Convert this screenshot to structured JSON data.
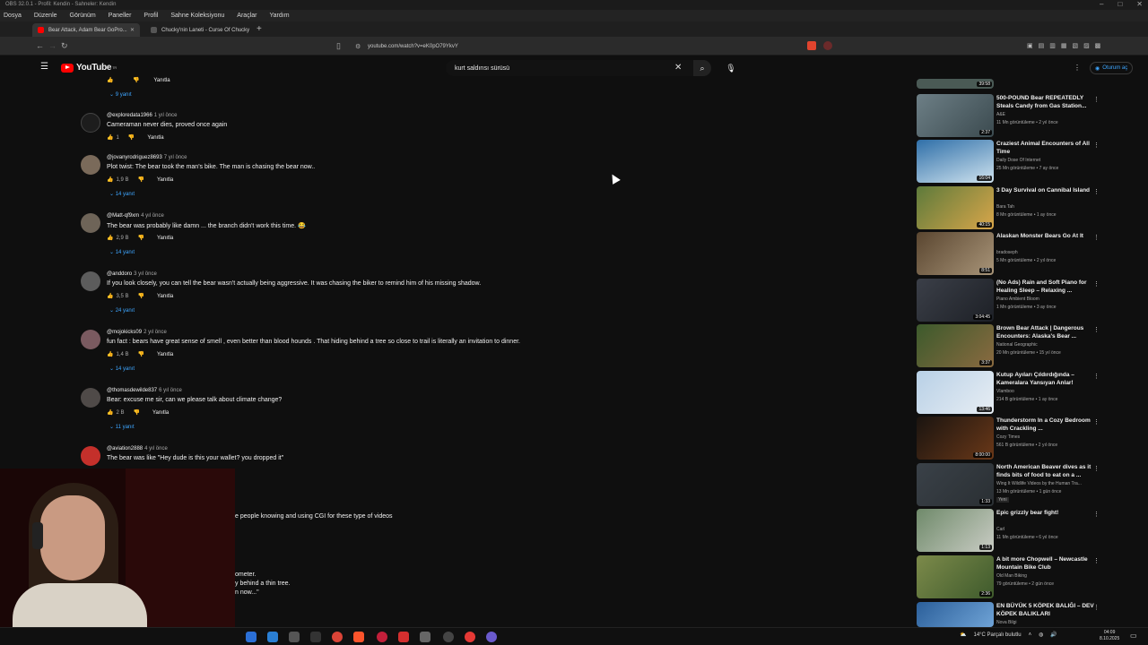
{
  "obs": {
    "title": "OBS 32.0.1 - Profil: Kendin - Sahneler: Kendin",
    "menu": [
      "Dosya",
      "Düzenle",
      "Görünüm",
      "Paneller",
      "Profil",
      "Sahne Koleksiyonu",
      "Araçlar",
      "Yardım"
    ]
  },
  "browser": {
    "tabs": [
      {
        "label": "Bear Attack, Adam Bear GoPro..."
      },
      {
        "label": "Chucky'nin Laneti - Curse Of Chucky"
      }
    ],
    "url": "youtube.com/watch?v=eK0pO79YkvY"
  },
  "youtube": {
    "logo_text": "YouTube",
    "logo_region": "TR",
    "search_value": "kurt saldırısı sürüsü",
    "signin_label": "Oturum aç"
  },
  "top_partial": {
    "replies": "9 yanıt",
    "reply_label": "Yanıtla"
  },
  "comments": [
    {
      "author": "@exploredata1966",
      "time": "1 yıl önce",
      "text": "Cameraman never dies, proved once again",
      "likes": "1",
      "reply_label": "Yanıtla",
      "replies": ""
    },
    {
      "author": "@jovanyrodriguez8693",
      "time": "7 yıl önce",
      "text": "Plot twist: The bear took the man's bike. The man is chasing the bear now..",
      "likes": "1,9 B",
      "reply_label": "Yanıtla",
      "replies": "14 yanıt"
    },
    {
      "author": "@Matt-qf9xm",
      "time": "4 yıl önce",
      "text": "The bear was probably like damn ... the branch didn't work this time. 😂",
      "likes": "2,9 B",
      "reply_label": "Yanıtla",
      "replies": "14 yanıt"
    },
    {
      "author": "@anddoro",
      "time": "3 yıl önce",
      "text": "If you look closely, you can tell the bear wasn't actually being aggressive. It was chasing the biker to remind him of his missing shadow.",
      "likes": "3,5 B",
      "reply_label": "Yanıtla",
      "replies": "24 yanıt"
    },
    {
      "author": "@mojokicks09",
      "time": "2 yıl önce",
      "text": "fun fact : bears have great sense of smell , even better than blood hounds . That hiding behind a tree so close to trail is literally an invitation to dinner.",
      "likes": "1,4 B",
      "reply_label": "Yanıtla",
      "replies": "14 yanıt"
    },
    {
      "author": "@thomasdewilde837",
      "time": "6 yıl önce",
      "text": "Bear: excuse me sir, can we please talk about climate change?",
      "likes": "2 B",
      "reply_label": "Yanıtla",
      "replies": "11 yanıt"
    },
    {
      "author": "@aviation2888",
      "time": "4 yıl önce",
      "text": "The bear was like \"Hey dude is this your wallet? you dropped it\"",
      "likes": "",
      "reply_label": "",
      "replies": ""
    }
  ],
  "partial_texts": [
    "e people knowing and using CGI for these type of videos",
    "ometer.",
    "y behind a thin tree.",
    "n now...\""
  ],
  "sidebar": [
    {
      "title": "",
      "channel": "",
      "stats": "",
      "duration": "39:58",
      "badge": ""
    },
    {
      "title": "500-POUND Bear REPEATEDLY Steals Candy from Gas Station...",
      "channel": "A&E",
      "stats": "11 Mn görüntüleme • 2 yıl önce",
      "duration": "2:37",
      "badge": ""
    },
    {
      "title": "Craziest Animal Encounters of All Time",
      "channel": "Daily Dose Of Internet",
      "stats": "25 Mn görüntüleme • 7 ay önce",
      "duration": "16:04",
      "badge": ""
    },
    {
      "title": "3 Day Survival on Cannibal Island",
      "channel": "Bara Tah",
      "stats": "8 Mn görüntüleme • 1 ay önce",
      "duration": "40:15",
      "badge": ""
    },
    {
      "title": "Alaskan Monster Bears Go At It",
      "channel": "bradoseph",
      "stats": "5 Mn görüntüleme • 2 yıl önce",
      "duration": "8:51",
      "badge": ""
    },
    {
      "title": "(No Ads) Rain and Soft Piano for Healing Sleep – Relaxing ...",
      "channel": "Piano Ambient Bloom",
      "stats": "1 Mn görüntüleme • 3 ay önce",
      "duration": "3:04:45",
      "badge": ""
    },
    {
      "title": "Brown Bear Attack | Dangerous Encounters: Alaska's Bear ...",
      "channel": "National Geographic",
      "stats": "20 Mn görüntüleme • 15 yıl önce",
      "duration": "3:37",
      "badge": ""
    },
    {
      "title": "Kutup Ayıları Çıldırdığında – Kameralara Yansıyan Anlar!",
      "channel": "Vlamboo",
      "stats": "214 B görüntüleme • 1 ay önce",
      "duration": "13:46",
      "badge": ""
    },
    {
      "title": "Thunderstorm In a Cozy Bedroom with Crackling ...",
      "channel": "Cozy Times",
      "stats": "561 B görüntüleme • 2 yıl önce",
      "duration": "8:00:00",
      "badge": ""
    },
    {
      "title": "North American Beaver dives as it finds bits of food to eat on a ...",
      "channel": "Wing It Wildlife Videos by the Human Tra...",
      "stats": "13 Mn görüntüleme • 1 gün önce",
      "duration": "1:33",
      "badge": "Yeni"
    },
    {
      "title": "Epic grizzly bear fight!",
      "channel": "Carl",
      "stats": "11 Mn görüntüleme • 6 yıl önce",
      "duration": "1:13",
      "badge": ""
    },
    {
      "title": "A bit more Chopwell – Newcastle Mountain Bike Club",
      "channel": "Old Man Biking",
      "stats": "79 görüntüleme • 2 gün önce",
      "duration": "2:36",
      "badge": ""
    },
    {
      "title": "EN BÜYÜK 5 KÖPEK BALIĞI – DEV KÖPEK BALIKLARI",
      "channel": "Nova Bilgi",
      "stats": "",
      "duration": "",
      "badge": ""
    }
  ],
  "taskbar": {
    "weather": "14°C Parçalı bulutlu",
    "time": "04:09",
    "date": "8.10.2025"
  },
  "colors": {
    "bg": "#0f0f0f",
    "text": "#f1f1f1",
    "muted": "#aaaaaa",
    "link": "#3ea6ff",
    "yt_red": "#ff0000"
  }
}
